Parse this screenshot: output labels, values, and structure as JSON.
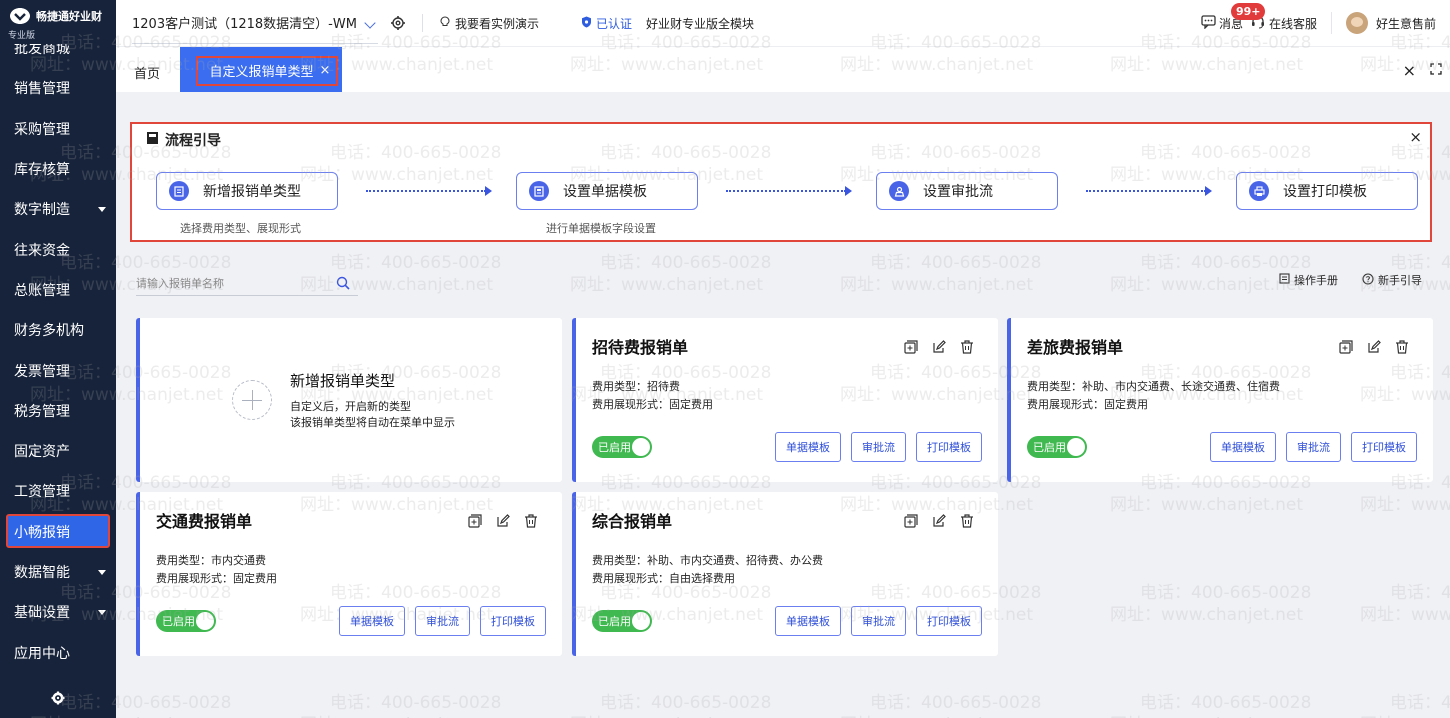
{
  "app": {
    "brand": "畅捷通好业财",
    "edition_tag": "专业版"
  },
  "sidebar": {
    "items": [
      {
        "label": "批发商城",
        "has_caret": false
      },
      {
        "label": "销售管理",
        "has_caret": false
      },
      {
        "label": "采购管理",
        "has_caret": false
      },
      {
        "label": "库存核算",
        "has_caret": false
      },
      {
        "label": "数字制造",
        "has_caret": true
      },
      {
        "label": "往来资金",
        "has_caret": false
      },
      {
        "label": "总账管理",
        "has_caret": false
      },
      {
        "label": "财务多机构",
        "has_caret": false
      },
      {
        "label": "发票管理",
        "has_caret": false
      },
      {
        "label": "税务管理",
        "has_caret": false
      },
      {
        "label": "固定资产",
        "has_caret": false
      },
      {
        "label": "工资管理",
        "has_caret": false
      },
      {
        "label": "小畅报销",
        "has_caret": false,
        "active": true
      },
      {
        "label": "数据智能",
        "has_caret": true
      },
      {
        "label": "基础设置",
        "has_caret": true
      },
      {
        "label": "应用中心",
        "has_caret": false
      }
    ],
    "settings_icon": "gear-icon"
  },
  "topbar": {
    "account": "1203客户测试（1218数据清空）-WM",
    "demo_label": "我要看实例演示",
    "verified_label": "已认证",
    "edition_label": "好业财专业版全模块",
    "messages_label": "消息",
    "messages_badge": "99+",
    "service_label": "在线客服",
    "user_name": "好生意售前"
  },
  "tabs": {
    "home_label": "首页",
    "active_label": "自定义报销单类型",
    "active_close": "×",
    "close_all": "×"
  },
  "guide": {
    "title": "流程引导",
    "close": "×",
    "steps": [
      {
        "label": "新增报销单类型",
        "desc": "选择费用类型、展现形式",
        "icon": "receipt-icon"
      },
      {
        "label": "设置单据模板",
        "desc": "进行单据模板字段设置",
        "icon": "template-icon"
      },
      {
        "label": "设置审批流",
        "desc": "",
        "icon": "approval-icon"
      },
      {
        "label": "设置打印模板",
        "desc": "",
        "icon": "printer-icon"
      }
    ]
  },
  "search": {
    "placeholder": "请输入报销单名称"
  },
  "helpers": {
    "manual": "操作手册",
    "guide": "新手引导"
  },
  "add_card": {
    "title": "新增报销单类型",
    "desc1": "自定义后，开启新的类型",
    "desc2": "该报销单类型将自动在菜单中显示"
  },
  "cards": [
    {
      "title": "招待费报销单",
      "type": "费用类型：招待费",
      "form": "费用展现形式：固定费用",
      "status": "已启用",
      "buttons": [
        "单据模板",
        "审批流",
        "打印模板"
      ]
    },
    {
      "title": "差旅费报销单",
      "type": "费用类型：补助、市内交通费、长途交通费、住宿费",
      "form": "费用展现形式：固定费用",
      "status": "已启用",
      "buttons": [
        "单据模板",
        "审批流",
        "打印模板"
      ]
    },
    {
      "title": "交通费报销单",
      "type": "费用类型：市内交通费",
      "form": "费用展现形式：固定费用",
      "status": "已启用",
      "buttons": [
        "单据模板",
        "审批流",
        "打印模板"
      ]
    },
    {
      "title": "综合报销单",
      "type": "费用类型：补助、市内交通费、招待费、办公费",
      "form": "费用展现形式：自由选择费用",
      "status": "已启用",
      "buttons": [
        "单据模板",
        "审批流",
        "打印模板"
      ]
    }
  ],
  "watermark": {
    "phone": "电话：400-665-0028",
    "site": "网址：www.chanjet.net"
  },
  "colors": {
    "sidebar_bg": "#17233a",
    "accent": "#3a6df0",
    "highlight_border": "#e0473a",
    "enabled_green": "#3fb950",
    "badge_red": "#e23b3b"
  }
}
